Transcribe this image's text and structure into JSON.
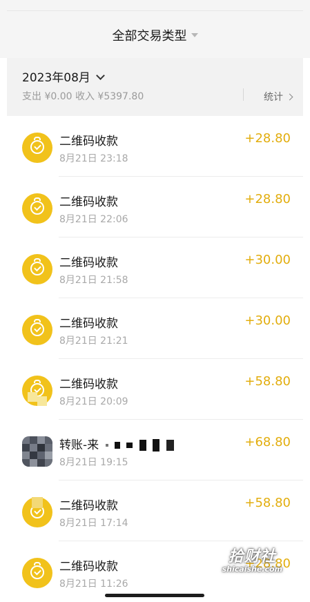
{
  "header": {
    "filter_label": "全部交易类型"
  },
  "month_section": {
    "month_label": "2023年08月",
    "summary": "支出 ¥0.00 收入 ¥5397.80",
    "stats_label": "统计"
  },
  "transactions": [
    {
      "title": "二维码收款",
      "time": "8月21日 23:18",
      "amount": "+28.80",
      "icon": "money-bag-icon"
    },
    {
      "title": "二维码收款",
      "time": "8月21日 22:06",
      "amount": "+28.80",
      "icon": "money-bag-icon"
    },
    {
      "title": "二维码收款",
      "time": "8月21日 21:58",
      "amount": "+30.00",
      "icon": "money-bag-icon"
    },
    {
      "title": "二维码收款",
      "time": "8月21日 21:21",
      "amount": "+30.00",
      "icon": "money-bag-icon"
    },
    {
      "title": "二维码收款",
      "time": "8月21日 20:09",
      "amount": "+58.80",
      "icon": "money-bag-icon"
    },
    {
      "title": "转账-来",
      "time": "8月21日 19:15",
      "amount": "+68.80",
      "icon": "avatar-icon"
    },
    {
      "title": "二维码收款",
      "time": "8月21日 17:14",
      "amount": "+58.80",
      "icon": "money-bag-icon"
    },
    {
      "title": "二维码收款",
      "time": "8月21日 11:26",
      "amount": "+28.80",
      "icon": "money-bag-icon"
    }
  ],
  "watermark": {
    "main": "拾财社",
    "sub": "shicaishe.com"
  },
  "colors": {
    "accent": "#e2ad0d",
    "icon_bg": "#f1c21b"
  }
}
